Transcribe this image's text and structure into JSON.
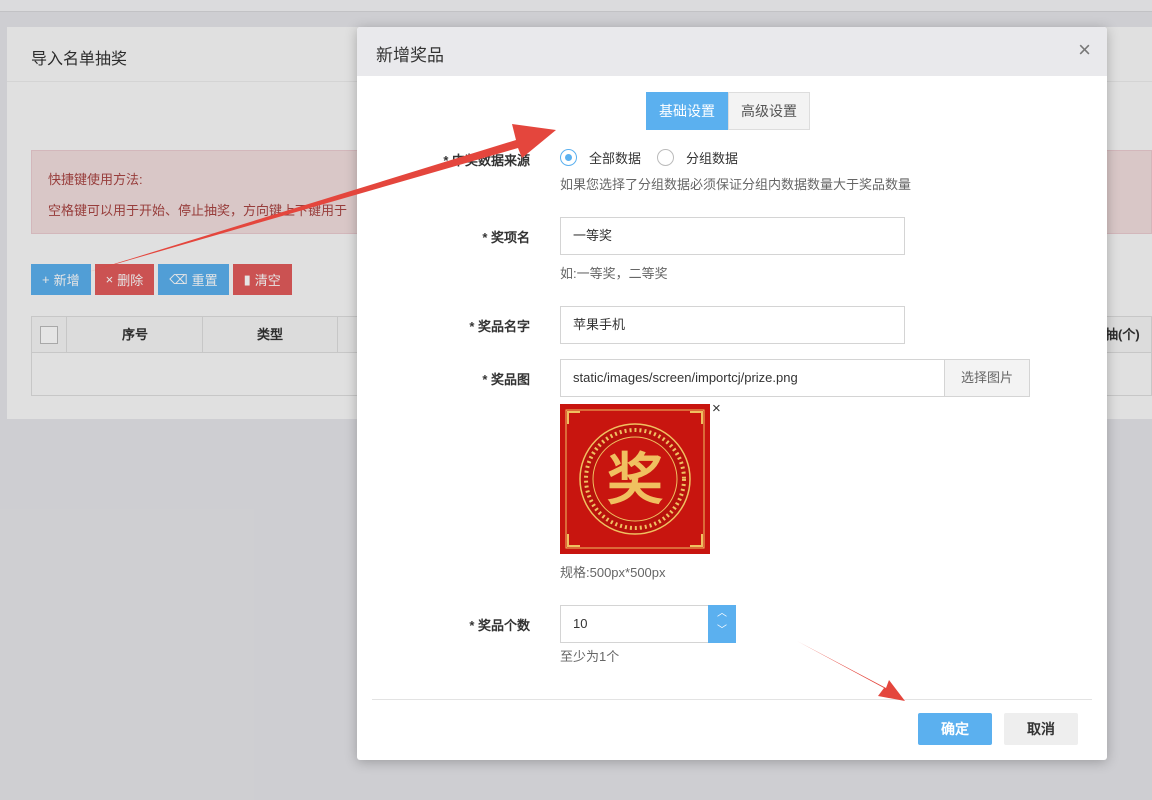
{
  "page": {
    "title": "导入名单抽奖",
    "alert": {
      "line1": "快捷键使用方法:",
      "line2": "空格键可以用于开始、停止抽奖，方向键上下键用于"
    },
    "buttons": {
      "add": "新增",
      "delete": "删除",
      "reset": "重置",
      "clear": "清空"
    },
    "table": {
      "columns": [
        "序号",
        "类型"
      ],
      "last_column": "次抽(个)"
    }
  },
  "modal": {
    "title": "新增奖品",
    "tabs": [
      "基础设置",
      "高级设置"
    ],
    "data_source": {
      "label": "* 中奖数据来源",
      "options": [
        "全部数据",
        "分组数据"
      ],
      "hint": "如果您选择了分组数据必须保证分组内数据数量大于奖品数量"
    },
    "item_name": {
      "label": "* 奖项名",
      "value": "一等奖",
      "hint": "如:一等奖，二等奖"
    },
    "prize_name": {
      "label": "* 奖品名字",
      "value": "苹果手机"
    },
    "prize_image": {
      "label": "* 奖品图",
      "value": "static/images/screen/importcj/prize.png",
      "button": "选择图片",
      "glyph": "奖",
      "hint": "规格:500px*500px"
    },
    "prize_count": {
      "label": "* 奖品个数",
      "value": "10",
      "hint": "至少为1个"
    },
    "ok": "确定",
    "cancel": "取消"
  },
  "colors": {
    "primary": "#5bb0ef",
    "danger": "#e25c5c",
    "annotation_arrow": "#e4463d",
    "prize_red": "#c8150f",
    "prize_gold": "#f0c060"
  }
}
